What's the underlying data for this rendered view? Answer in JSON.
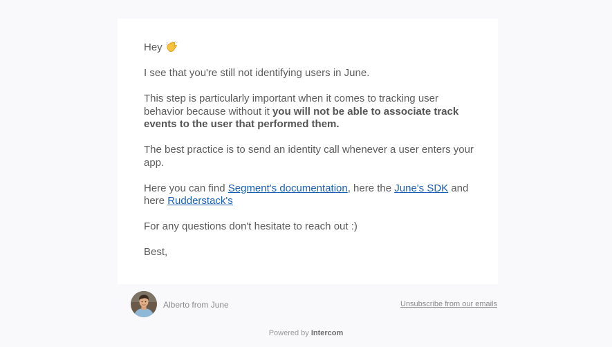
{
  "email": {
    "greeting": "Hey",
    "greeting_icon": "waving-hand-icon",
    "p1": "I see that you're still not identifying users in June.",
    "p2_text": "This step is particularly important when it comes to tracking user behavior because without it ",
    "p2_bold": "you will not be able to associate track events to the user that performed them.",
    "p3": "The best practice is to send an identity call whenever a user enters your app.",
    "p4_prefix": "Here you can find ",
    "link_segment": "Segment's documentation",
    "p4_mid": ", here the ",
    "link_june_sdk": "June's SDK",
    "p4_and": " and here ",
    "link_rudderstack": "Rudderstack's",
    "p5": "For any questions don't hesitate to reach out :)",
    "signoff": "Best,"
  },
  "footer": {
    "avatar_icon": "sender-avatar",
    "sender": "Alberto from June",
    "unsubscribe": "Unsubscribe from our emails"
  },
  "powered_by": {
    "prefix": "Powered by ",
    "brand": "Intercom"
  },
  "colors": {
    "background": "#f9f8fa",
    "card": "#ffffff",
    "body_text": "#5b5b5b",
    "link": "#1a5fb4",
    "muted": "#8a8a8a"
  }
}
